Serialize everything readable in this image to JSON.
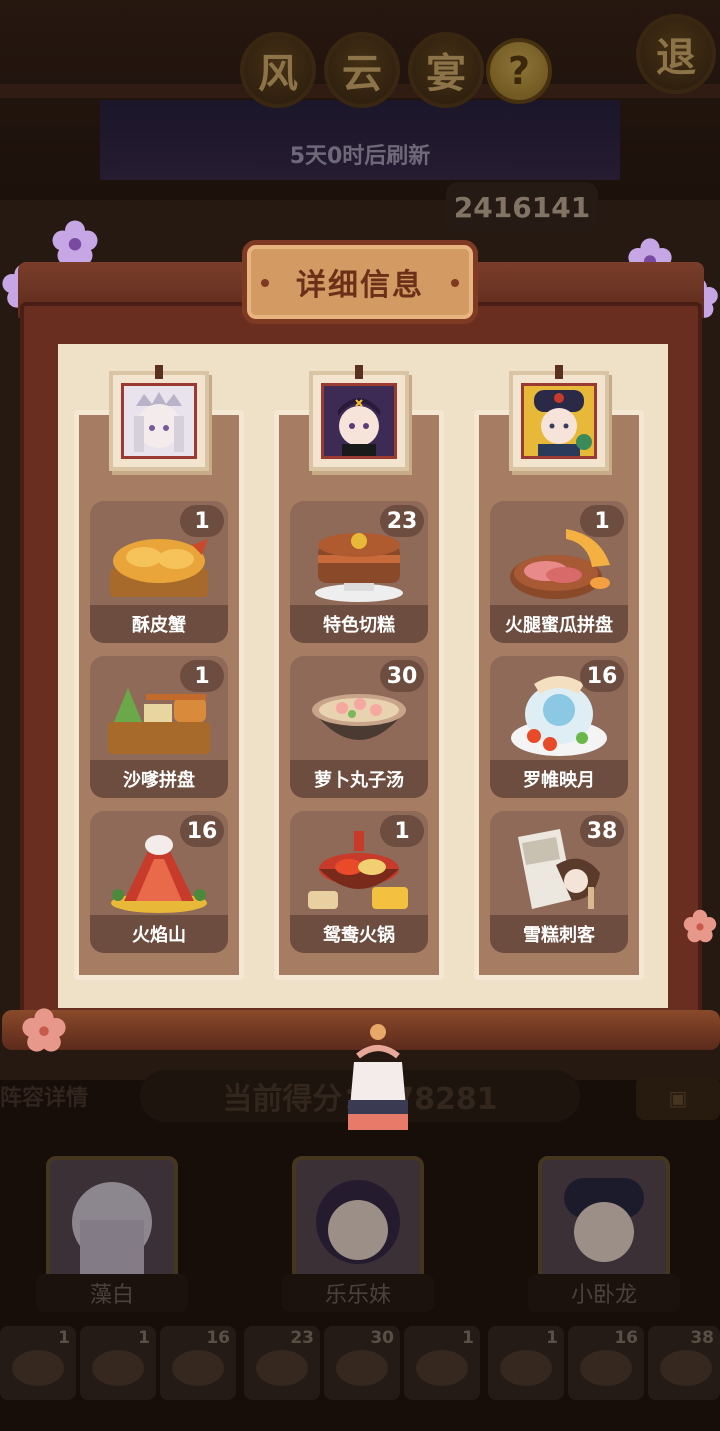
{
  "header": {
    "title_chars": [
      "风",
      "云",
      "宴"
    ],
    "help_label": "?",
    "exit_label": "退",
    "refresh_text": "5天0时后刷新",
    "total_score": "2416141"
  },
  "modal": {
    "title": "详细信息",
    "columns": [
      {
        "character": "藻白",
        "dishes": [
          {
            "name": "酥皮蟹",
            "count": "1"
          },
          {
            "name": "沙嗲拼盘",
            "count": "1"
          },
          {
            "name": "火焰山",
            "count": "16"
          }
        ]
      },
      {
        "character": "乐乐妹",
        "dishes": [
          {
            "name": "特色切糕",
            "count": "23"
          },
          {
            "name": "萝卜丸子汤",
            "count": "30"
          },
          {
            "name": "鸳鸯火锅",
            "count": "1"
          }
        ]
      },
      {
        "character": "小卧龙",
        "dishes": [
          {
            "name": "火腿蜜瓜拼盘",
            "count": "1"
          },
          {
            "name": "罗帷映月",
            "count": "16"
          },
          {
            "name": "雪糕刺客",
            "count": "38"
          }
        ]
      }
    ]
  },
  "background": {
    "lineup_label": "阵容详情",
    "current_score_text": "当前得分：178281",
    "characters": [
      "藻白",
      "乐乐妹",
      "小卧龙"
    ],
    "dish_slots": [
      "1",
      "1",
      "16",
      "23",
      "30",
      "1",
      "1",
      "16",
      "38"
    ]
  },
  "colors": {
    "panel_bg": "#efe0c8",
    "column_bg": "#a67c62",
    "card_bg": "#8f6a58",
    "label_bg": "#6d4d40",
    "frame": "#6a2e20"
  }
}
